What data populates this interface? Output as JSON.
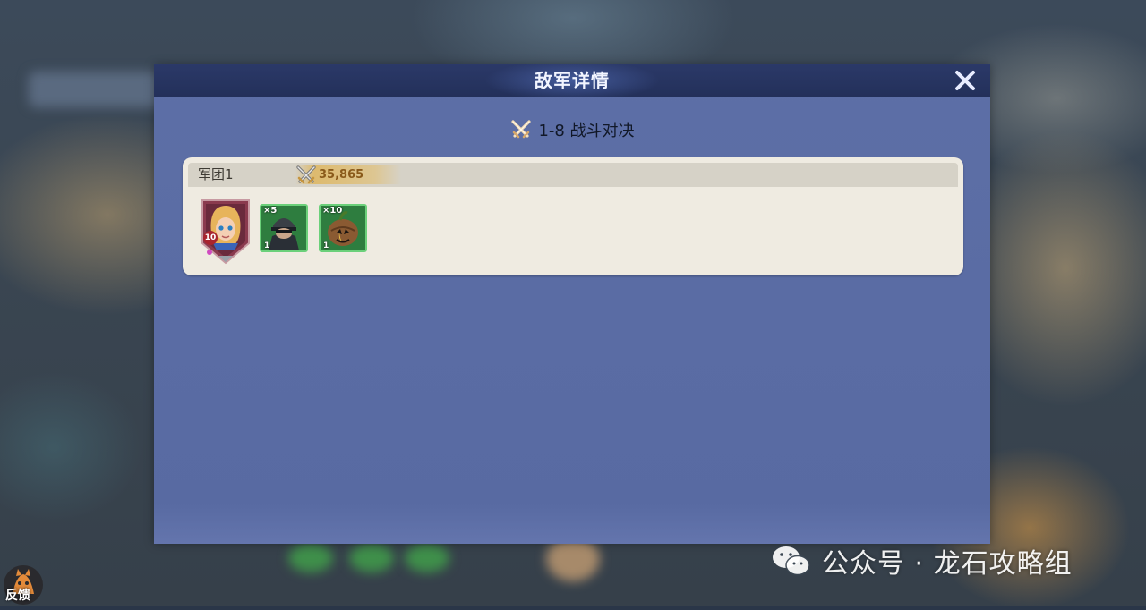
{
  "dialog": {
    "title": "敌军详情",
    "close_icon": "close-icon",
    "stage_icon": "crossed-swords-icon",
    "stage_title": "1-8 战斗对决"
  },
  "armies": [
    {
      "name": "军团1",
      "power_icon": "crossed-swords-icon",
      "power": "35,865",
      "hero": {
        "level": "10",
        "icon": "hero-portrait-icon"
      },
      "units": [
        {
          "count": "×5",
          "level": "1",
          "icon": "soldier-helmet-icon"
        },
        {
          "count": "×10",
          "level": "1",
          "icon": "pumpkin-creature-icon"
        }
      ]
    }
  ],
  "watermark": {
    "icon": "wechat-icon",
    "text": "公众号 · 龙石攻略组"
  },
  "feedback": {
    "label": "反馈",
    "icon": "feedback-avatar-icon"
  },
  "colors": {
    "panel": "#5a6ca4",
    "header": "#26335f",
    "card": "#efebe1",
    "unit_border": "#6bd07a",
    "power_text": "#8a5a1a"
  }
}
